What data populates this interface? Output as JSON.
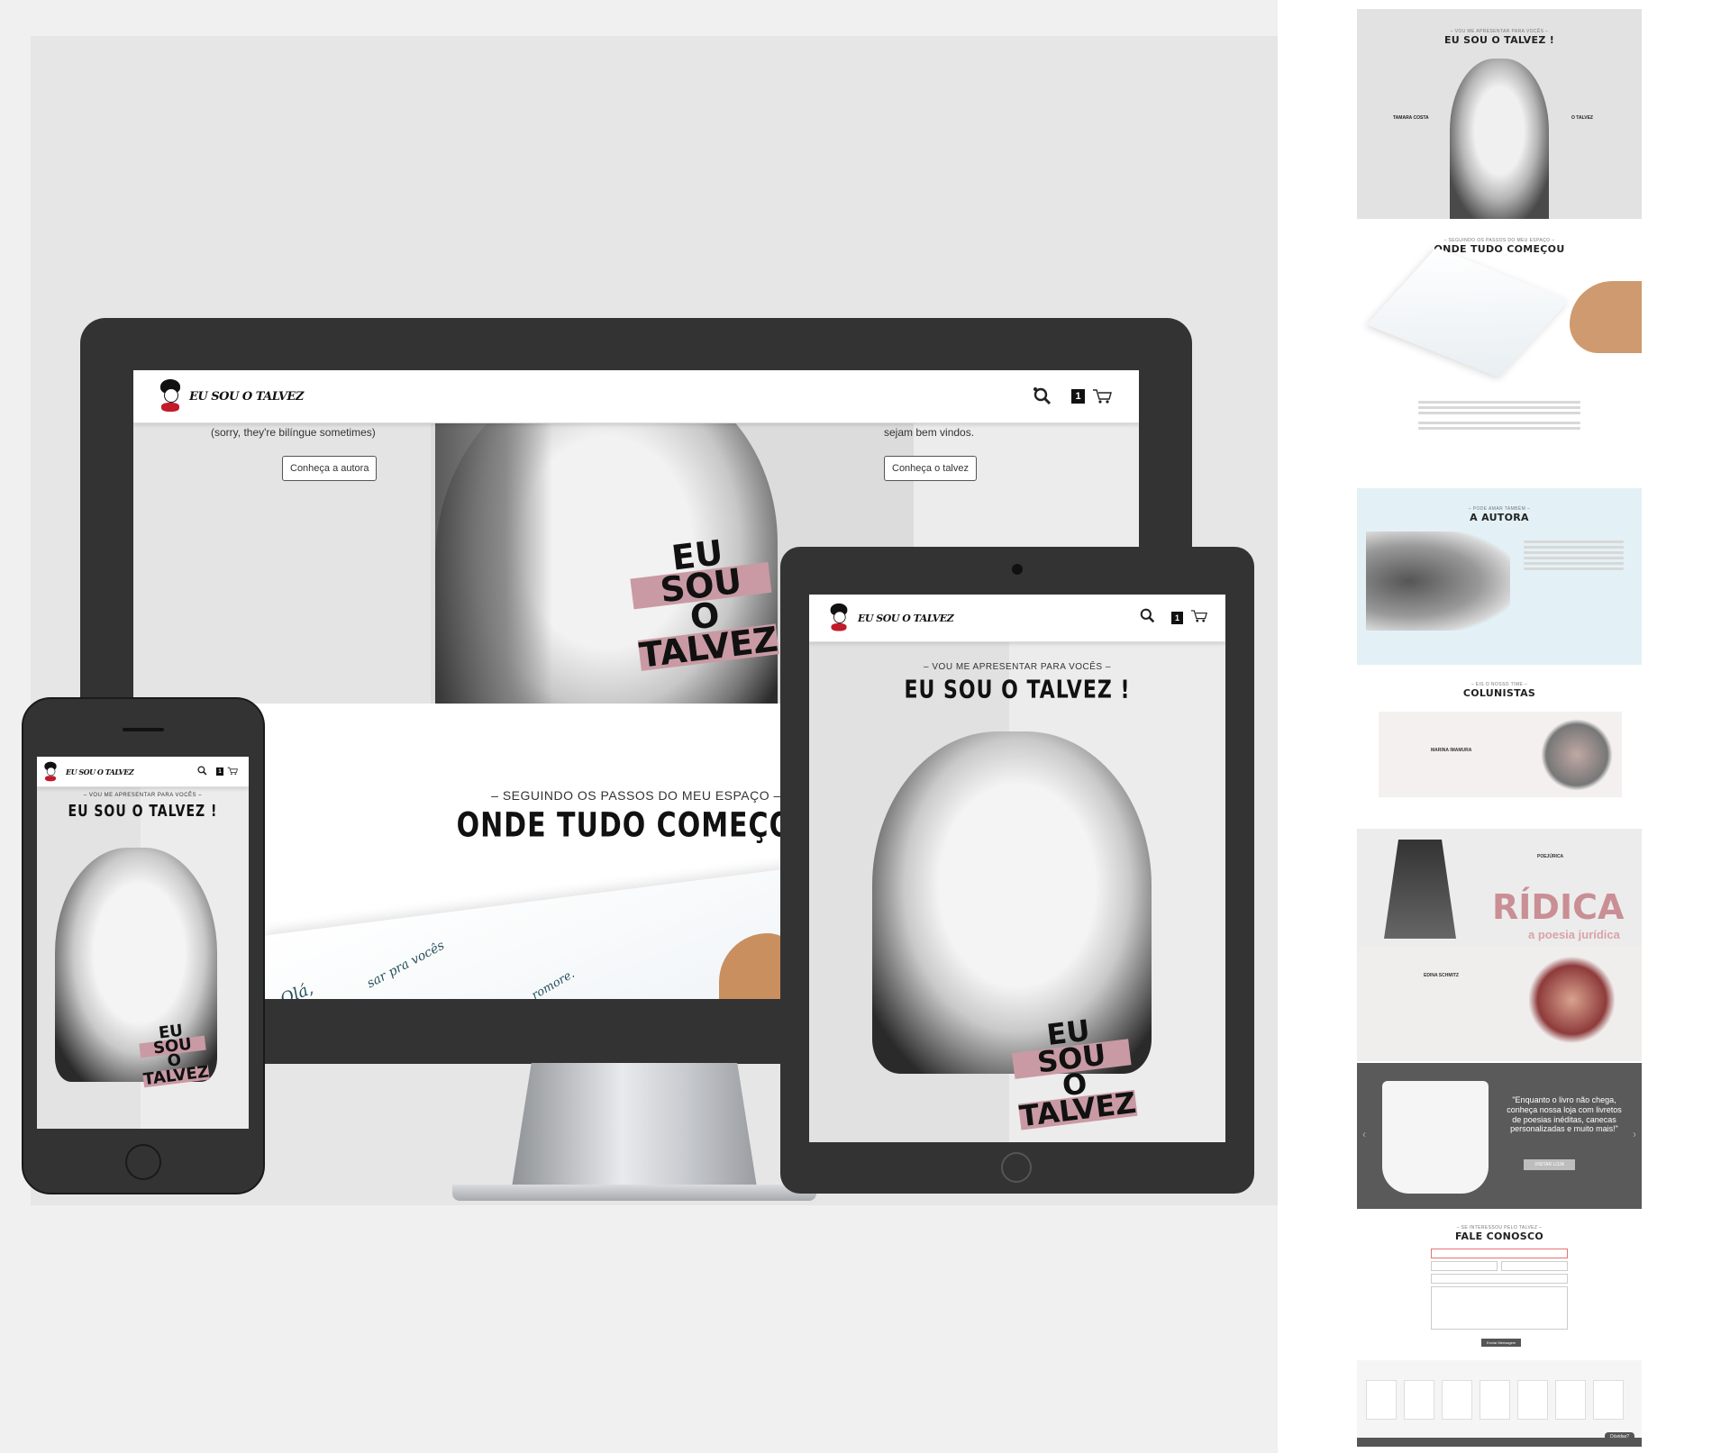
{
  "site": {
    "brand": "EU SOU O TALVEZ",
    "cart_count": "1"
  },
  "desktop": {
    "hero_left_note": "(sorry, they're bilíngue sometimes)",
    "hero_right_note": "sejam bem vindos.",
    "hero_left_button": "Conheça a autora",
    "hero_right_button": "Conheça o talvez",
    "section_kicker": "– SEGUINDO OS PASSOS DO MEU ESPAÇO –",
    "section_title": "ONDE TUDO COMEÇOU",
    "letter_snippets": [
      "Olá,",
      "sar pra vocês",
      "romore."
    ]
  },
  "tablet": {
    "kicker": "– VOU ME APRESENTAR PARA VOCÊS –",
    "title": "EU SOU O TALVEZ !",
    "stamp": [
      "EU",
      "SOU",
      "O",
      "TALVEZ"
    ]
  },
  "phone": {
    "kicker": "– VOU ME APRESENTAR PARA VOCÊS –",
    "title": "EU SOU O TALVEZ !",
    "stamp": [
      "EU",
      "SOU",
      "O",
      "TALVEZ"
    ]
  },
  "preview": {
    "hero_kicker": "– VOU ME APRESENTAR PARA VOCÊS –",
    "hero_title": "EU SOU O TALVEZ !",
    "hero_left_heading": "TAMARA COSTA",
    "hero_right_heading": "O TALVEZ",
    "start_kicker": "– SEGUINDO OS PASSOS DO MEU ESPAÇO –",
    "start_title": "ONDE TUDO COMEÇOU",
    "author_kicker": "– PODE AMAR TAMBÉM –",
    "author_title": "A AUTORA",
    "columnists_kicker": "– EIS O NOSSO TIME –",
    "columnists_title": "COLUNISTAS",
    "columnist_1": "MARINA IMAMURA",
    "columnist_2": "POEJÚRICA",
    "columnist_2_banner": "RÍDICA",
    "columnist_2_sub": "a poesia jurídica",
    "columnist_3": "EDINA SCHMITZ",
    "shop_quote": "\"Enquanto o livro não chega, conheça nossa loja com livretos de poesias inéditas, canecas personalizadas e muito mais!\"",
    "shop_button": "VISITAR LOJA",
    "contact_kicker": "– SE INTERESSOU PELO TALVEZ –",
    "contact_title": "FALE CONOSCO",
    "contact_button": "Enviar Mensagem",
    "footer_chat": "Dúvidas?"
  }
}
